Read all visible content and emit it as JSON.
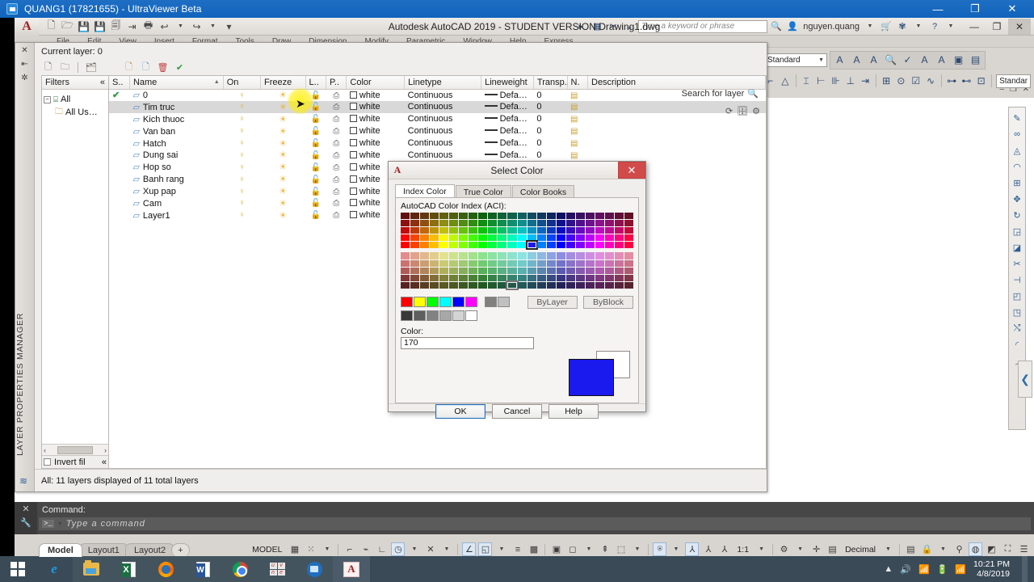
{
  "ultraviewer": {
    "title": "QUANG1 (17821655) - UltraViewer Beta",
    "minimize": "—",
    "maximize": "❐",
    "close": "✕"
  },
  "acad": {
    "title": "Autodesk AutoCAD 2019 - STUDENT VERSION     Drawing1.dwg",
    "quick_access": [
      "new-icon",
      "open-icon",
      "save-icon",
      "saveas-icon",
      "plot-preview-icon",
      "export-icon",
      "print-icon",
      "undo-icon",
      "redo-icon",
      "customize-icon"
    ],
    "menu_items": [
      "File",
      "Edit",
      "View",
      "Insert",
      "Format",
      "Tools",
      "Draw",
      "Dimension",
      "Modify",
      "Parametric",
      "Window",
      "Help",
      "Express"
    ],
    "infocenter": {
      "search_placeholder": "Type a keyword or phrase",
      "user": "nguyen.quang"
    },
    "window_buttons": {
      "minimize": "—",
      "restore": "❐",
      "close": "✕"
    },
    "doc_buttons": {
      "minimize": "–",
      "restore": "❐",
      "close": "✕"
    },
    "ribbon_right": {
      "style_combo": "Standard",
      "style_combo2": "Standar",
      "text_tools": [
        "text-style-icon",
        "text-height-icon",
        "text-justify-icon",
        "text-zoom-icon",
        "spell-check-icon",
        "text-edit-icon",
        "text-annotative-icon",
        "text-frame-icon",
        "text-table-icon"
      ],
      "dim_tools": [
        "dim-linear-icon",
        "dim-aligned-icon",
        "dim-angular-icon",
        "dim-baseline-icon",
        "dim-continue-icon",
        "dim-ordinate-icon",
        "dim-break-icon",
        "dim-center-icon",
        "dim-inspect-icon",
        "dim-jog-icon",
        "dim-update-icon",
        "dim-override-icon",
        "dim-style-icon"
      ]
    },
    "right_tools": [
      "draw-icon",
      "erase-icon",
      "mirror-icon",
      "offset-icon",
      "array-icon",
      "move-icon",
      "rotate-icon",
      "scale-icon",
      "stretch-icon",
      "trim-icon",
      "extend-icon",
      "break-icon",
      "join-icon",
      "chamfer-icon",
      "fillet-icon",
      "explode-icon"
    ],
    "right_tab": "❮"
  },
  "layer_palette": {
    "vertical_title": "LAYER PROPERTIES MANAGER",
    "current_layer_label": "Current layer: 0",
    "search_placeholder": "Search for layer",
    "search_icon": "search-icon",
    "toolbar_icons": [
      "new-layer-icon",
      "new-layer-vp-icon",
      "delete-layer-icon",
      "set-current-icon",
      "new-property-filter-icon",
      "new-group-filter-icon",
      "layer-states-icon",
      "refresh-icon"
    ],
    "settings_icons": [
      "refresh-icon",
      "layer-states-manager-icon",
      "settings-icon"
    ],
    "side_buttons": [
      "close-icon",
      "auto-hide-icon",
      "properties-icon"
    ],
    "filters": {
      "header": "Filters",
      "collapse": "«",
      "tree": [
        {
          "label": "All",
          "icon": "all-filter-icon",
          "expander": "−",
          "indent": 0
        },
        {
          "label": "All Us…",
          "icon": "folder-icon",
          "expander": "",
          "indent": 1
        }
      ],
      "invert_filter_label": "Invert fil",
      "invert_collapse": "«",
      "scroll_left": "‹",
      "scroll_right": "›"
    },
    "columns": [
      "S..",
      "Name",
      "On",
      "Freeze",
      "L..",
      "P..",
      "Color",
      "Linetype",
      "Lineweight",
      "Transp..",
      "N.",
      "Description"
    ],
    "sort_arrow": "▲",
    "rows": [
      {
        "status": "current",
        "name": "0",
        "on": "on",
        "freeze": "thawed",
        "lock": "unlocked",
        "plot": "plot",
        "color": "white",
        "linetype": "Continuous",
        "lineweight": "Defa…",
        "transparency": "0",
        "new_vp": "newvp",
        "description": ""
      },
      {
        "status": "layer",
        "name": "Tim truc",
        "on": "on",
        "freeze": "thawed",
        "lock": "unlocked",
        "plot": "plot",
        "color": "white",
        "linetype": "Continuous",
        "lineweight": "Defa…",
        "transparency": "0",
        "new_vp": "newvp",
        "description": ""
      },
      {
        "status": "layer",
        "name": "Kich thuoc",
        "on": "on",
        "freeze": "thawed",
        "lock": "unlocked",
        "plot": "plot",
        "color": "white",
        "linetype": "Continuous",
        "lineweight": "Defa…",
        "transparency": "0",
        "new_vp": "newvp",
        "description": ""
      },
      {
        "status": "layer",
        "name": "Van ban",
        "on": "on",
        "freeze": "thawed",
        "lock": "unlocked",
        "plot": "plot",
        "color": "white",
        "linetype": "Continuous",
        "lineweight": "Defa…",
        "transparency": "0",
        "new_vp": "newvp",
        "description": ""
      },
      {
        "status": "layer",
        "name": "Hatch",
        "on": "on",
        "freeze": "thawed",
        "lock": "unlocked",
        "plot": "plot",
        "color": "white",
        "linetype": "Continuous",
        "lineweight": "Defa…",
        "transparency": "0",
        "new_vp": "newvp",
        "description": ""
      },
      {
        "status": "layer",
        "name": "Dung sai",
        "on": "on",
        "freeze": "thawed",
        "lock": "unlocked",
        "plot": "plot",
        "color": "white",
        "linetype": "Continuous",
        "lineweight": "Defa…",
        "transparency": "0",
        "new_vp": "newvp",
        "description": ""
      },
      {
        "status": "layer",
        "name": "Hop so",
        "on": "on",
        "freeze": "thawed",
        "lock": "unlocked",
        "plot": "plot",
        "color": "white",
        "linetype": "Continuous",
        "lineweight": "",
        "transparency": "",
        "new_vp": "",
        "description": ""
      },
      {
        "status": "layer",
        "name": "Banh rang",
        "on": "on",
        "freeze": "thawed",
        "lock": "unlocked",
        "plot": "plot",
        "color": "white",
        "linetype": "Continuous",
        "lineweight": "",
        "transparency": "",
        "new_vp": "",
        "description": ""
      },
      {
        "status": "layer",
        "name": "Xup pap",
        "on": "on",
        "freeze": "thawed",
        "lock": "unlocked",
        "plot": "plot",
        "color": "white",
        "linetype": "Continuous",
        "lineweight": "",
        "transparency": "",
        "new_vp": "",
        "description": ""
      },
      {
        "status": "layer",
        "name": "Cam",
        "on": "on",
        "freeze": "thawed",
        "lock": "unlocked",
        "plot": "plot",
        "color": "white",
        "linetype": "Continuous",
        "lineweight": "",
        "transparency": "",
        "new_vp": "",
        "description": ""
      },
      {
        "status": "layer",
        "name": "Layer1",
        "on": "on",
        "freeze": "thawed",
        "lock": "unlocked",
        "plot": "plot",
        "color": "white",
        "linetype": "Continuous",
        "lineweight": "",
        "transparency": "",
        "new_vp": "",
        "description": ""
      }
    ],
    "status_text": "All: 11 layers displayed of 11 total layers"
  },
  "select_color_dialog": {
    "title": "Select Color",
    "app_icon": "autocad-a-icon",
    "close": "✕",
    "tabs": [
      {
        "label": "Index Color",
        "active": true
      },
      {
        "label": "True Color",
        "active": false
      },
      {
        "label": "Color Books",
        "active": false
      }
    ],
    "aci_label": "AutoCAD Color Index (ACI):",
    "bylayer_label": "ByLayer",
    "byblock_label": "ByBlock",
    "color_label": "Color:",
    "color_value": "170",
    "selected_color_hex": "#1a1aee",
    "previous_color_hex": "#ffffff",
    "buttons": {
      "ok": "OK",
      "cancel": "Cancel",
      "help": "Help"
    },
    "standard_colors": [
      "#ff0000",
      "#ffff00",
      "#00ff00",
      "#00ffff",
      "#0000ff",
      "#ff00ff"
    ],
    "gray_pair": [
      "#808080",
      "#c0c0c0"
    ],
    "gray_ramp": [
      "#383838",
      "#5e5e5e",
      "#828282",
      "#a8a8a8",
      "#d4d4d4",
      "#ffffff"
    ],
    "main_grid_hues": [
      "#d40000",
      "#d44400",
      "#d48800",
      "#d4cc00",
      "#a8d400",
      "#64d400",
      "#20d400",
      "#00d42c",
      "#00d470",
      "#00d4b4",
      "#00c4d4",
      "#0080d4",
      "#003cd4",
      "#0000d4",
      "#2c00d4",
      "#7000d4",
      "#b400d4",
      "#d400c4",
      "#d40080",
      "#d4003c",
      "#ff0000",
      "#ff6a00",
      "#ffd400",
      "#aa0044"
    ],
    "selected_cell_index": {
      "row": 4,
      "col": 13
    },
    "selected_low_cell": {
      "row": 4,
      "col": 11
    }
  },
  "command_line": {
    "history": "Command:",
    "prompt_glyph": ">_",
    "placeholder": "Type a command",
    "close_icon": "close-icon",
    "tool_icon": "customize-icon"
  },
  "status_bar": {
    "layout_tabs": [
      {
        "label": "Model",
        "active": true
      },
      {
        "label": "Layout1",
        "active": false
      },
      {
        "label": "Layout2",
        "active": false
      },
      {
        "label": "+",
        "active": false
      }
    ],
    "model_label": "MODEL",
    "scale_label": "1:1",
    "units_label": "Decimal",
    "icons": [
      "grid-display-icon",
      "snap-mode-icon",
      "snap-dropdown-icon",
      "ortho-mode-icon",
      "polar-tracking-icon",
      "object-snap-icon",
      "osnap-tracking-icon",
      "osnap-dropdown-icon",
      "ducs-icon",
      "dyn-dropdown-icon",
      "dynamic-input-icon",
      "lineweight-icon",
      "transparency-icon",
      "selection-cycling-icon",
      "3dosnap-icon",
      "3dosnap-dropdown-icon",
      "annotation-monitor-icon",
      "annotation-scale-icon",
      "annotation-visibility-dropdown-icon",
      "annotation-visibility-icon",
      "autoscale-icon",
      "annotation-scale-list-icon",
      "workspace-icon",
      "workspace-dropdown-icon",
      "fullscreen-icon",
      "units-icon",
      "quickprop-icon",
      "lock-ui-icon",
      "lock-dropdown-icon",
      "isolate-objects-icon",
      "hardware-accel-icon",
      "clean-screen-icon",
      "fullscreen-toggle-icon",
      "customization-icon"
    ]
  },
  "taskbar": {
    "start": "start-button",
    "items": [
      {
        "name": "internet-explorer",
        "pinned": false
      },
      {
        "name": "file-explorer",
        "pinned": true
      },
      {
        "name": "excel",
        "pinned": true
      },
      {
        "name": "firefox",
        "pinned": true
      },
      {
        "name": "word",
        "pinned": true
      },
      {
        "name": "chrome",
        "pinned": true
      },
      {
        "name": "unikey",
        "pinned": true
      },
      {
        "name": "ultraviewer",
        "pinned": true
      },
      {
        "name": "autocad",
        "pinned": true,
        "active": true
      }
    ],
    "tray_icons": [
      "show-hidden-icon",
      "volume-icon",
      "network-error-icon",
      "battery-icon",
      "signal-icon"
    ],
    "clock_time": "10:21 PM",
    "clock_date": "4/8/2019"
  }
}
